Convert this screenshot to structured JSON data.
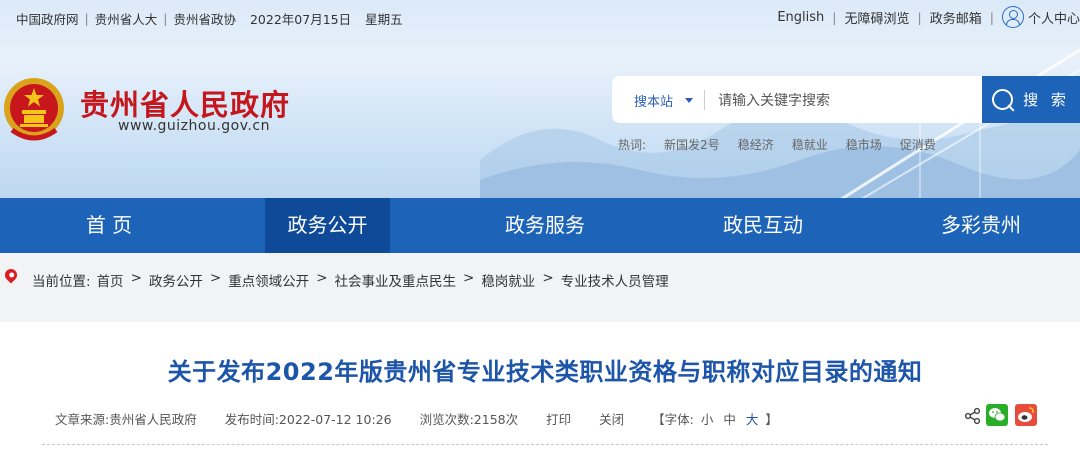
{
  "topbar": {
    "links": [
      "中国政府网",
      "贵州省人大",
      "贵州省政协"
    ],
    "date": "2022年07月15日",
    "weekday": "星期五",
    "right_links": [
      "English",
      "无障碍浏览",
      "政务邮箱"
    ],
    "user_center": "个人中心"
  },
  "header": {
    "site_name": "贵州省人民政府",
    "site_url": "www.guizhou.gov.cn"
  },
  "search": {
    "scope": "搜本站",
    "placeholder": "请输入关键字搜索",
    "button": "搜 索",
    "hot_label": "热词:",
    "hot_words": [
      "新国发2号",
      "稳经济",
      "稳就业",
      "稳市场",
      "促消费"
    ]
  },
  "nav": {
    "items": [
      "首 页",
      "政务公开",
      "政务服务",
      "政民互动",
      "多彩贵州"
    ],
    "active_index": 1
  },
  "breadcrumb": {
    "label": "当前位置:",
    "items": [
      "首页",
      "政务公开",
      "重点领域公开",
      "社会事业及重点民生",
      "稳岗就业",
      "专业技术人员管理"
    ]
  },
  "article": {
    "title": "关于发布2022年版贵州省专业技术类职业资格与职称对应目录的通知",
    "source": "文章来源:贵州省人民政府",
    "publish_time": "发布时间:2022-07-12 10:26",
    "views": "浏览次数:2158次",
    "print": "打印",
    "close": "关闭",
    "font_label": "【字体:",
    "font_small": "小",
    "font_medium": "中",
    "font_large": "大",
    "font_end": "】"
  },
  "colors": {
    "brand_blue": "#1d64b8",
    "nav_active": "#0f4a99",
    "title_red": "#c4171d",
    "article_title": "#1d55a8"
  }
}
